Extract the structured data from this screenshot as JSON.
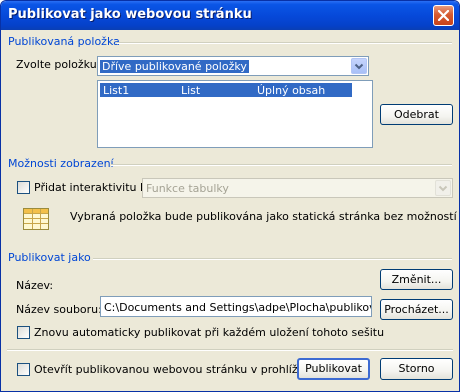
{
  "window": {
    "title": "Publikovat jako webovou stránku"
  },
  "published_item": {
    "section_title": "Publikovaná položka",
    "select_label": "Zvolte položku:",
    "select_value": "Dříve publikované položky",
    "list_items": [
      {
        "name": "List1",
        "type": "List",
        "content": "Úplný obsah",
        "selected": true
      }
    ],
    "remove_button": "Odebrat"
  },
  "view_options": {
    "section_title": "Možnosti zobrazení",
    "interactivity_label": "Přidat interaktivitu k:",
    "interactivity_checked": false,
    "interactivity_select_value": "Funkce tabulky",
    "info_icon": "table-icon",
    "info_text": "Vybraná položka bude publikována jako statická stránka bez možností interakce."
  },
  "publish_as": {
    "section_title": "Publikovat jako",
    "name_label": "Název:",
    "change_button": "Změnit...",
    "filename_label": "Název souboru:",
    "filename_value": "C:\\Documents and Settings\\adpe\\Plocha\\publikování no",
    "browse_button": "Procházet...",
    "autopublish_label": "Znovu automaticky publikovat při každém uložení tohoto sešitu",
    "autopublish_checked": false
  },
  "footer": {
    "open_in_browser_label": "Otevřít publikovanou webovou stránku v prohlížeči",
    "open_in_browser_checked": false,
    "publish_button": "Publikovat",
    "cancel_button": "Storno"
  },
  "colors": {
    "titlebar": "#0a55e6",
    "section_title": "#0046d5",
    "selection": "#316ac5",
    "dialog_background": "#ece9d8"
  }
}
